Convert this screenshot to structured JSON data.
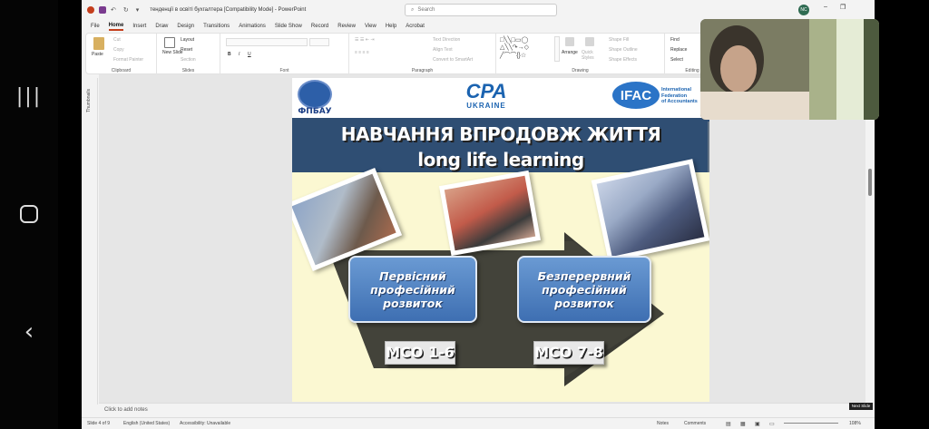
{
  "window": {
    "doc_title": "тенденції в освіті бухгалтера  [Compatibility Mode]  -  PowerPoint",
    "search_placeholder": "Search",
    "user_initials": "NC"
  },
  "tabs": [
    "File",
    "Home",
    "Insert",
    "Draw",
    "Design",
    "Transitions",
    "Animations",
    "Slide Show",
    "Record",
    "Review",
    "View",
    "Help",
    "Acrobat"
  ],
  "active_tab": "Home",
  "ribbon": {
    "clipboard": {
      "label": "Clipboard",
      "paste": "Paste",
      "cut": "Cut",
      "copy": "Copy",
      "format_painter": "Format Painter"
    },
    "slides": {
      "label": "Slides",
      "new_slide": "New Slide",
      "layout": "Layout",
      "reset": "Reset",
      "section": "Section"
    },
    "font": {
      "label": "Font"
    },
    "paragraph": {
      "label": "Paragraph",
      "text_direction": "Text Direction",
      "align_text": "Align Text",
      "convert_smartart": "Convert to SmartArt"
    },
    "drawing": {
      "label": "Drawing",
      "arrange": "Arrange",
      "quick_styles": "Quick Styles",
      "shape_fill": "Shape Fill",
      "shape_outline": "Shape Outline",
      "shape_effects": "Shape Effects"
    },
    "editing": {
      "label": "Editing",
      "find": "Find",
      "replace": "Replace",
      "select": "Select"
    }
  },
  "thumbnails_label": "Thumbnails",
  "slide": {
    "logo_left_text": "ФПБАУ",
    "logo_center_big": "CPA",
    "logo_center_small": "UKRAINE",
    "logo_right_big": "IFAC",
    "logo_right_text_1": "International",
    "logo_right_text_2": "Federation",
    "logo_right_text_3": "of Accountants",
    "title_ua": "НАВЧАННЯ ВПРОДОВЖ ЖИТТЯ",
    "title_en": "long life learning",
    "box_left": [
      "Первісний",
      "професійний",
      "розвиток"
    ],
    "box_right": [
      "Безперервний",
      "професійний",
      "розвиток"
    ],
    "mco_left": "МСО 1-6",
    "mco_right": "МСО 7-8"
  },
  "notes_placeholder": "Click to add notes",
  "status": {
    "slide_info": "Slide 4 of 9",
    "language": "English (United States)",
    "accessibility": "Accessibility: Unavailable",
    "notes": "Notes",
    "comments": "Comments",
    "zoom": "108%",
    "next_slide": "Next Slide"
  },
  "colors": {
    "accent": "#c43e1c",
    "banner": "#2f4e73",
    "slide_bg": "#fbf8d2",
    "box_blue": "#4a7cc0"
  }
}
